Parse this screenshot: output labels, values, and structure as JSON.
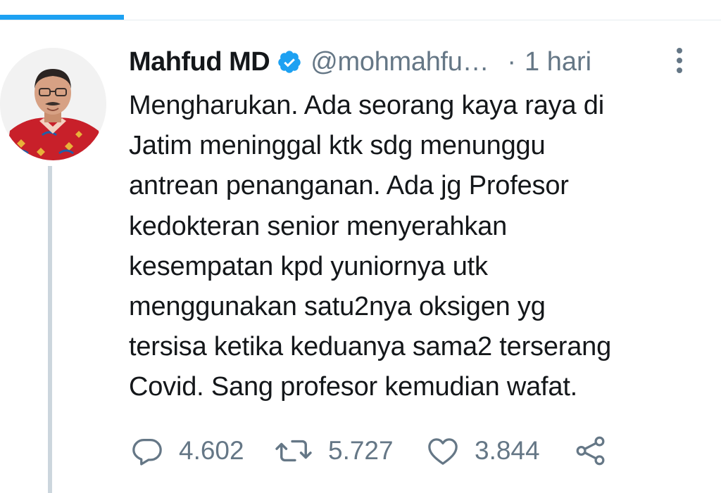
{
  "tweet": {
    "author": {
      "display_name": "Mahfud MD",
      "handle": "@mohmahfu…",
      "verified": true
    },
    "separator": "·",
    "time": "1 hari",
    "text_lines": [
      "Mengharukan. Ada seorang kaya raya di",
      "Jatim meninggal ktk sdg menunggu",
      "antrean penanganan. Ada jg Profesor",
      "kedokteran senior menyerahkan",
      "kesempatan kpd yuniornya utk",
      "menggunakan satu2nya oksigen yg",
      "tersisa ketika keduanya sama2 terserang",
      "Covid. Sang profesor kemudian wafat."
    ],
    "actions": {
      "reply": {
        "icon": "reply-icon",
        "count": "4.602"
      },
      "retweet": {
        "icon": "retweet-icon",
        "count": "5.727"
      },
      "like": {
        "icon": "heart-icon",
        "count": "3.844"
      },
      "share": {
        "icon": "share-icon"
      }
    }
  },
  "colors": {
    "accent": "#1da1f2",
    "text_primary": "#14171a",
    "text_secondary": "#657786",
    "thread_line": "#ccd6dd",
    "divider": "#e6ecf0"
  }
}
